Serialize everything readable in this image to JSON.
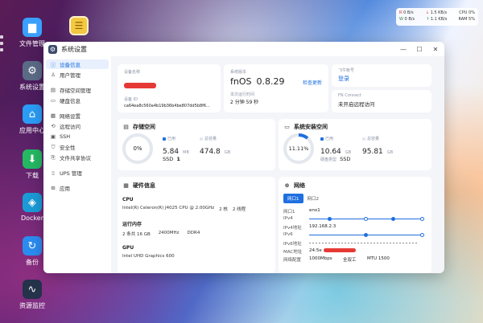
{
  "desktop": {
    "icons": [
      {
        "label": "文件管理",
        "icon": "folder-icon",
        "color": "#3aa0ff"
      },
      {
        "label": "系统设置",
        "icon": "gear-icon",
        "color": "#5b6b86"
      },
      {
        "label": "应用中心",
        "icon": "store-icon",
        "color": "#2b9cf5"
      },
      {
        "label": "下载",
        "icon": "download-icon",
        "color": "#25b862"
      },
      {
        "label": "Docker",
        "icon": "docker-icon",
        "color": "#1a9bd7"
      },
      {
        "label": "备份",
        "icon": "backup-icon",
        "color": "#2b8cf0"
      },
      {
        "label": "资源监控",
        "icon": "monitor-icon",
        "color": "#24324a"
      }
    ]
  },
  "sysmon": {
    "r_label": "R",
    "w_label": "W",
    "r_disk": "0",
    "w_disk": "0",
    "unit_bs": "B/s",
    "r_net": "1.5 KB/s",
    "w_net": "1.1 KB/s",
    "cpu_label": "CPU",
    "cpu_val": "0%",
    "ram_label": "RAM",
    "ram_val": "5%"
  },
  "window": {
    "title": "系统设置",
    "min_icon": "—",
    "max_icon": "☐",
    "close_icon": "✕"
  },
  "sidebar": {
    "items": [
      {
        "label": "设备信息",
        "icon": "info-icon",
        "active": true
      },
      {
        "label": "用户管理",
        "icon": "user-icon"
      },
      {
        "label": "存储空间管理",
        "icon": "storage-icon"
      },
      {
        "label": "硬盘信息",
        "icon": "disk-icon"
      },
      {
        "label": "网络设置",
        "icon": "network-icon"
      },
      {
        "label": "远程访问",
        "icon": "remote-icon"
      },
      {
        "label": "SSH",
        "icon": "ssh-icon"
      },
      {
        "label": "安全性",
        "icon": "shield-icon"
      },
      {
        "label": "文件共享协议",
        "icon": "share-icon"
      },
      {
        "label": "UPS 管理",
        "icon": "ups-icon"
      },
      {
        "label": "应用",
        "icon": "app-icon"
      }
    ]
  },
  "device": {
    "name_label": "设备名称",
    "id_label": "设备 ID",
    "id_value": "ca64ea8c560a4b19b36b4be807dd5b8f6..."
  },
  "system": {
    "version_label": "系统版本",
    "os_name": "fnOS",
    "version": "0.8.29",
    "check_update": "检查更新",
    "uptime_label": "本次运行时间",
    "uptime": "2 分钟 59 秒"
  },
  "fly": {
    "account_label": "飞牛帐号",
    "login": "登录",
    "connect_label": "FN Connect",
    "connect_status": "未开启远程访问"
  },
  "storage": {
    "title": "存储空间",
    "percent": "0%",
    "used_label": "已用",
    "used": "5.84",
    "used_unit": "MB",
    "total_label": "总容量",
    "total": "474.8",
    "total_unit": "GB",
    "type": "SSD",
    "count": "1",
    "used_color": "#1f6fe0"
  },
  "sysdisk": {
    "title": "系统安装空间",
    "percent": "11.11%",
    "used_label": "已用",
    "used": "10.64",
    "used_unit": "GB",
    "total_label": "总容量",
    "total": "95.81",
    "total_unit": "GB",
    "disk_type_label": "硬盘类型",
    "disk_type": "SSD",
    "used_fraction": 0.1111,
    "used_color": "#1f6fe0"
  },
  "hardware": {
    "title": "硬件信息",
    "cpu_label": "CPU",
    "cpu_model": "Intel(R) Celeron(R) J4025 CPU @ 2.00GHz",
    "cpu_cores": "2 核",
    "cpu_threads": "2 线程",
    "ram_label": "运行内存",
    "ram_size": "2 条共 16 GB",
    "ram_speed": "2400MHz",
    "ram_type": "DDR4",
    "gpu_label": "GPU",
    "gpu_model": "Intel UHD Graphics 600"
  },
  "network": {
    "title": "网络",
    "tabs": [
      "网口1",
      "网口2"
    ],
    "port_label": "网口1",
    "port_value": "eno1",
    "ipv4_label": "IPv4",
    "ipv4_addr_label": "IPv4地址",
    "ipv4_addr": "192.168.2.3",
    "ipv6_label": "IPv6",
    "ipv6_addr_label": "IPv6地址",
    "mac_label": "MAC地址",
    "mac_prefix": "24:5e",
    "speed_label": "网络配置",
    "speed": "1000Mbps",
    "duplex": "全双工",
    "mtu": "MTU 1500"
  }
}
